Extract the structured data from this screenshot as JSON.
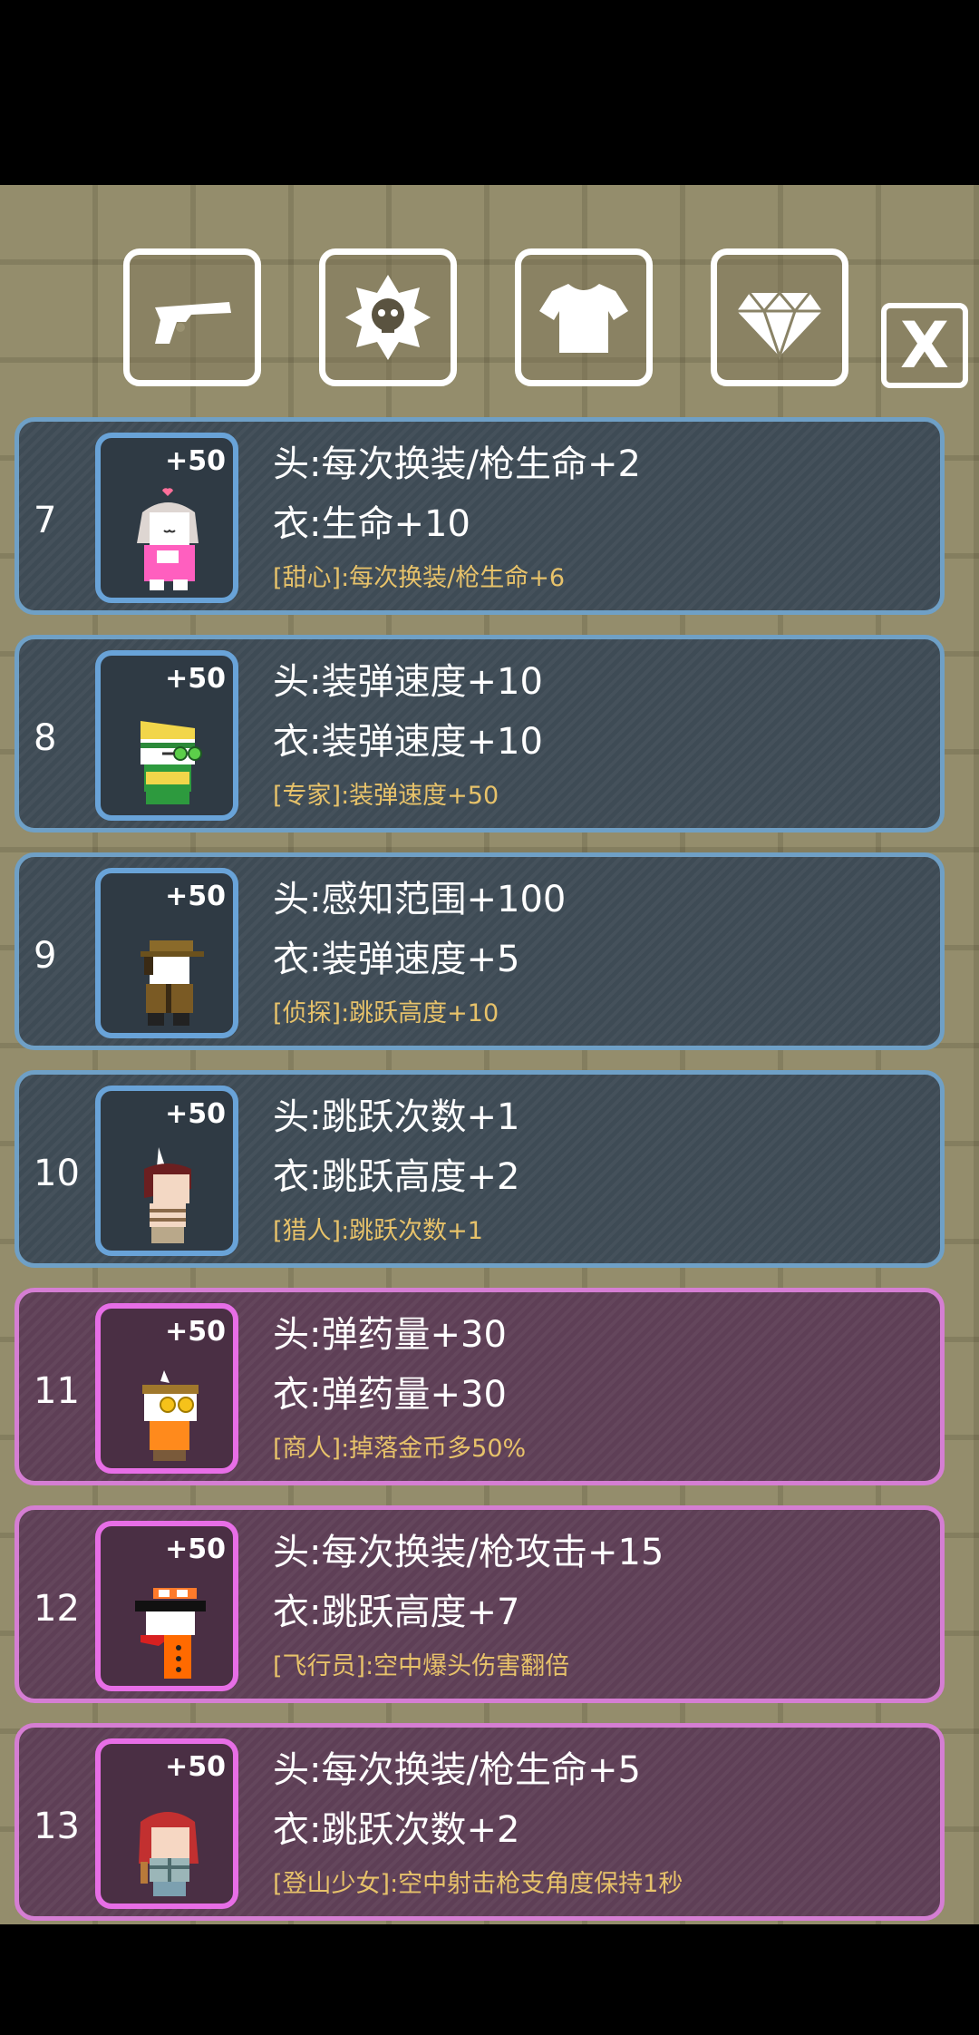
{
  "tabs": [
    {
      "name": "revolver-icon"
    },
    {
      "name": "skull-badge-icon"
    },
    {
      "name": "shirt-icon"
    },
    {
      "name": "diamond-icon"
    }
  ],
  "close_label": "X",
  "cards": [
    {
      "number": "7",
      "bonus": "+50",
      "head": "头:每次换装/枪生命+2",
      "body": "衣:生命+10",
      "trait": "[甜心]:每次换装/枪生命+6",
      "tier": "blue"
    },
    {
      "number": "8",
      "bonus": "+50",
      "head": "头:装弹速度+10",
      "body": "衣:装弹速度+10",
      "trait": "[专家]:装弹速度+50",
      "tier": "blue"
    },
    {
      "number": "9",
      "bonus": "+50",
      "head": "头:感知范围+100",
      "body": "衣:装弹速度+5",
      "trait": "[侦探]:跳跃高度+10",
      "tier": "blue"
    },
    {
      "number": "10",
      "bonus": "+50",
      "head": "头:跳跃次数+1",
      "body": "衣:跳跃高度+2",
      "trait": "[猎人]:跳跃次数+1",
      "tier": "blue"
    },
    {
      "number": "11",
      "bonus": "+50",
      "head": "头:弹药量+30",
      "body": "衣:弹药量+30",
      "trait": "[商人]:掉落金币多50%",
      "tier": "purple"
    },
    {
      "number": "12",
      "bonus": "+50",
      "head": "头:每次换装/枪攻击+15",
      "body": "衣:跳跃高度+7",
      "trait": "[飞行员]:空中爆头伤害翻倍",
      "tier": "purple"
    },
    {
      "number": "13",
      "bonus": "+50",
      "head": "头:每次换装/枪生命+5",
      "body": "衣:跳跃次数+2",
      "trait": "[登山少女]:空中射击枪支角度保持1秒",
      "tier": "purple"
    }
  ],
  "colors": {
    "blue_border": "#6fa0c6",
    "purple_border": "#d57ed3",
    "trait_text": "#e7c26a"
  }
}
